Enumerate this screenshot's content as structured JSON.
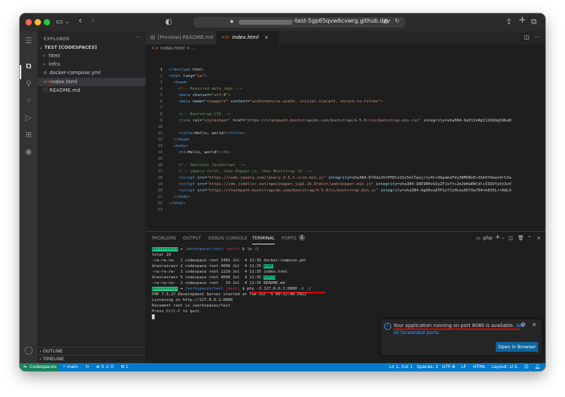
{
  "browser": {
    "url_suffix": "-test-5gp65qvw6cvwrg.github.dev"
  },
  "sidebar": {
    "title": "EXPLORER",
    "root": "TEST [CODESPACES]",
    "items": [
      {
        "label": "html",
        "type": "folder"
      },
      {
        "label": "infra",
        "type": "folder"
      },
      {
        "label": "docker-compose.yml",
        "type": "yaml"
      },
      {
        "label": "index.html",
        "type": "html"
      },
      {
        "label": "README.md",
        "type": "markdown"
      }
    ],
    "outline": "OUTLINE",
    "timeline": "TIMELINE"
  },
  "editor": {
    "tabs": [
      {
        "label": "[Preview] README.md",
        "active": false
      },
      {
        "label": "index.html",
        "active": true
      }
    ],
    "breadcrumb": {
      "file": "index.html",
      "rest": "> ..."
    },
    "lines": [
      {
        "n": "1",
        "t": "<!doctype html>"
      },
      {
        "n": "2",
        "t": "<html lang=\"ja\">"
      },
      {
        "n": "3",
        "t": "  <head>"
      },
      {
        "n": "4",
        "t": "    <!-- Required meta tags -->"
      },
      {
        "n": "5",
        "t": "    <meta charset=\"utf-8\">"
      },
      {
        "n": "6",
        "t": "    <meta name=\"viewport\" content=\"width=device-width, initial-scale=1, shrink-to-fit=no\">"
      },
      {
        "n": "7",
        "t": ""
      },
      {
        "n": "8",
        "t": "    <!-- Bootstrap CSS -->"
      },
      {
        "n": "9",
        "t": "    <link rel=\"stylesheet\" href=\"https://stackpath.bootstrapcdn.com/bootstrap/4.5.0/css/bootstrap.min.css\" integrity=\"sha384-9aIt2nRpC12Uk9gS9baD"
      },
      {
        "n": "10",
        "t": ""
      },
      {
        "n": "11",
        "t": "    <title>Hello, world!</title>"
      },
      {
        "n": "12",
        "t": "  </head>"
      },
      {
        "n": "13",
        "t": "  <body>"
      },
      {
        "n": "14",
        "t": "    <h1>Hello, world!</h1>"
      },
      {
        "n": "15",
        "t": ""
      },
      {
        "n": "16",
        "t": "    <!-- Optional JavaScript -->"
      },
      {
        "n": "17",
        "t": "    <!-- jQuery first, then Popper.js, then Bootstrap JS -->"
      },
      {
        "n": "18",
        "t": "    <script src=\"https://code.jquery.com/jquery-3.5.1.slim.min.js\" integrity=\"sha384-DfXdz2htPH0lsSSs5nCTpuj/zy4C+OGpamoFVy38MVBnE+IbbVYUew+OrCXa"
      },
      {
        "n": "19",
        "t": "    <script src=\"https://cdn.jsdelivr.net/npm/popper.js@1.16.0/dist/umd/popper.min.js\" integrity=\"sha384-Q6E9RHvbIyZFJoft+2mJbHaEWldlvI9IOYy5n3zV"
      },
      {
        "n": "20",
        "t": "    <script src=\"https://stackpath.bootstrapcdn.com/bootstrap/4.5.0/js/bootstrap.min.js\" integrity=\"sha384-OgVRvuATP1z7JjHLkuOU7Xw704+h835Lr+6QL9"
      },
      {
        "n": "21",
        "t": "  </body>"
      },
      {
        "n": "22",
        "t": "</html>"
      },
      {
        "n": "23",
        "t": ""
      }
    ]
  },
  "panel": {
    "tabs": [
      {
        "label": "PROBLEMS"
      },
      {
        "label": "OUTPUT"
      },
      {
        "label": "DEBUG CONSOLE"
      },
      {
        "label": "TERMINAL"
      },
      {
        "label": "PORTS"
      }
    ],
    "ports_count": "1",
    "shell": "php",
    "terminal": {
      "prompt1": {
        "path": "/workspaces/test",
        "branch": "(main)",
        "cmd": "$ ls -l"
      },
      "total": "total 20",
      "files": [
        {
          "meta": "-rw-rw-rw-  1 codespace root 1491 Jul  4 11:35 ",
          "name": "docker-compose.yml",
          "dir": false
        },
        {
          "meta": "drwxrwxrwx+ 2 codespace root 4096 Jul  4 11:35 ",
          "name": "html",
          "dir": true
        },
        {
          "meta": "-rw-rw-rw-  1 codespace root 1226 Jul  4 11:35 ",
          "name": "index.html",
          "dir": false
        },
        {
          "meta": "drwxrwxrwx+ 5 codespace root 4096 Jul  4 11:35 ",
          "name": "infra",
          "dir": true
        },
        {
          "meta": "-rw-rw-rw-  1 codespace root   33 Jul  4 11:35 ",
          "name": "README.md",
          "dir": false
        }
      ],
      "prompt2": {
        "path": "/workspaces/test",
        "branch": "(main)",
        "cmd": "$ php -S 127.0.0.1:8080 -t ./"
      },
      "out1": "PHP 7.3.27 Development Server started at Tue Jul  5 00:12:08 2022",
      "out2": "Listening on http://127.0.0.1:8080",
      "out3": "Document root is /workspaces/test",
      "out4": "Press Ctrl-C to quit."
    }
  },
  "notification": {
    "message": "Your application running on port 8080 is available.",
    "link_see": "See",
    "link_rest": "all forwarded ports",
    "button": "Open in Browser"
  },
  "statusbar": {
    "remote": "Codespaces",
    "branch": "main",
    "errors": "0",
    "warnings": "0",
    "ports": "1",
    "position": "Ln 1, Col 1",
    "spaces": "Spaces: 2",
    "encoding": "UTF-8",
    "eol": "LF",
    "language": "HTML",
    "layout": "Layout: U.S."
  },
  "colors": {
    "accent": "#007acc",
    "remote": "#16825d",
    "annotation_red": "#e00000"
  }
}
